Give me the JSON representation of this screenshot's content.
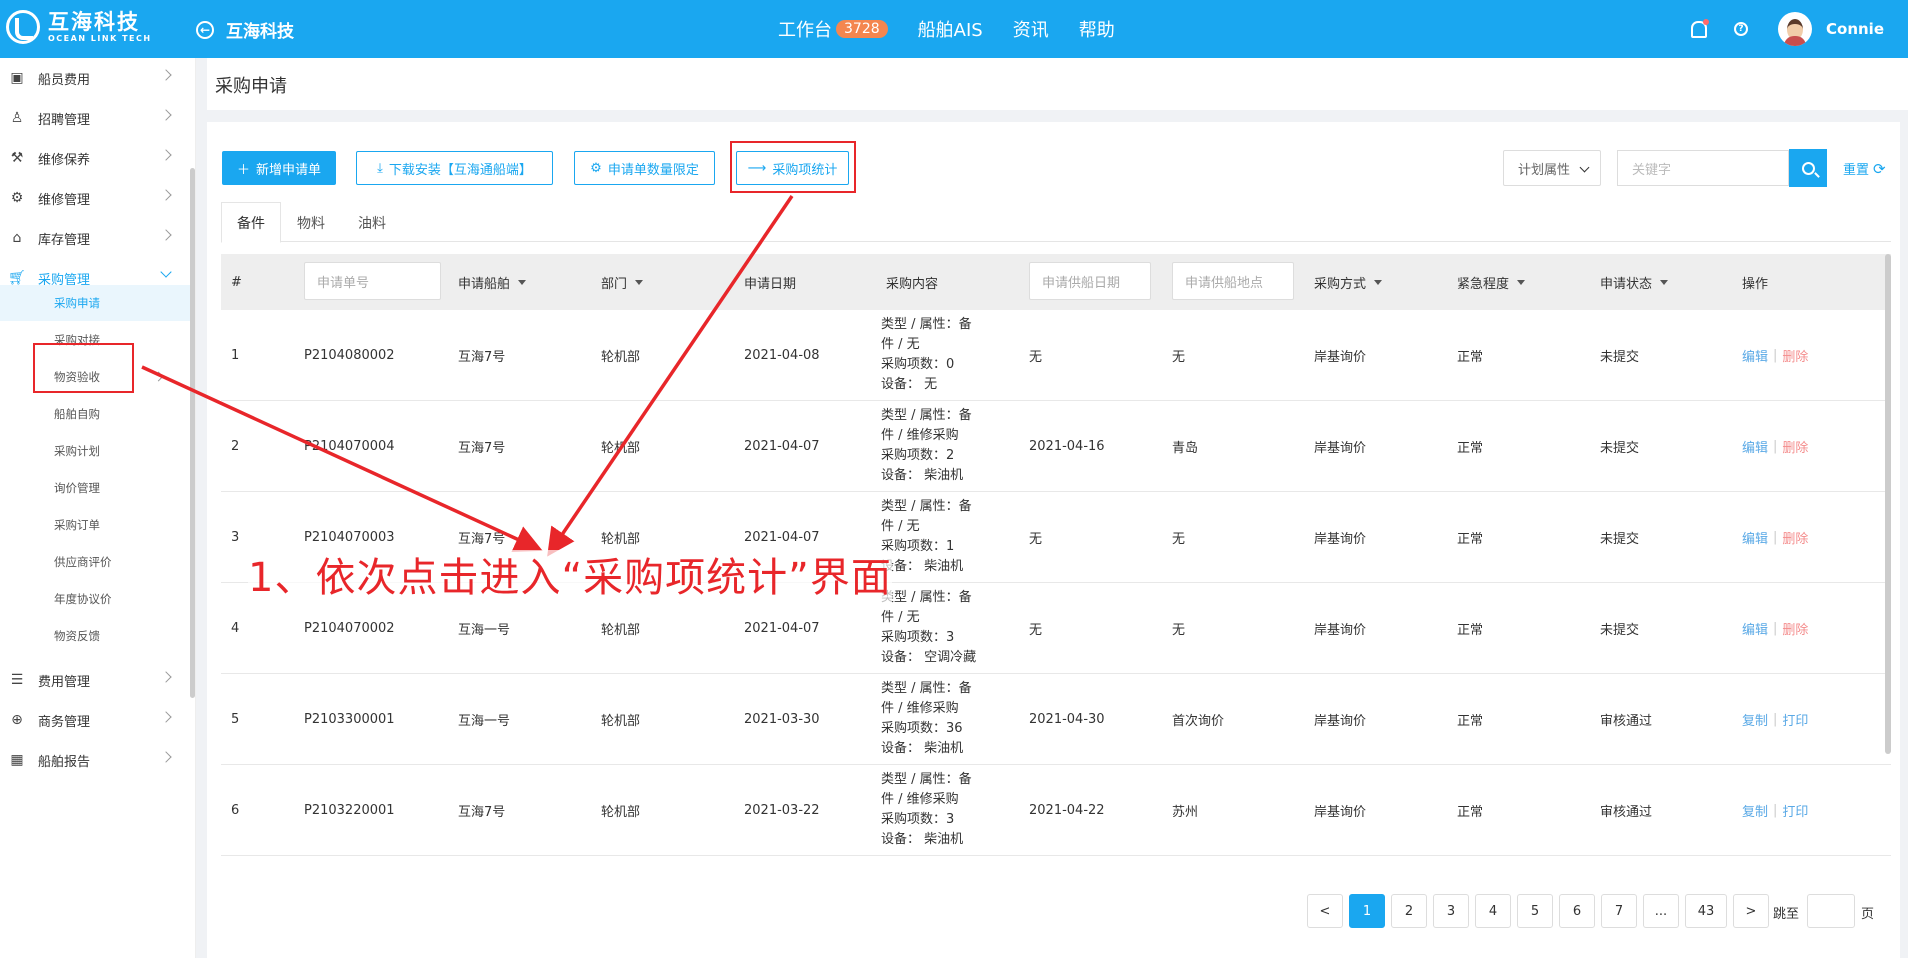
{
  "topbar": {
    "logo_cn": "互海科技",
    "logo_en": "OCEAN LINK TECH",
    "back_label": "互海科技",
    "nav": [
      {
        "label": "工作台",
        "badge": "3728"
      },
      {
        "label": "船舶AIS"
      },
      {
        "label": "资讯"
      },
      {
        "label": "帮助"
      }
    ],
    "username": "Connie"
  },
  "sidebar": {
    "items": [
      {
        "label": "船员费用",
        "icon": "wallet-icon"
      },
      {
        "label": "招聘管理",
        "icon": "user-icon"
      },
      {
        "label": "维修保养",
        "icon": "hammer-icon"
      },
      {
        "label": "维修管理",
        "icon": "wrench-icon"
      },
      {
        "label": "库存管理",
        "icon": "home-icon"
      },
      {
        "label": "采购管理",
        "icon": "cart-icon"
      }
    ],
    "sub_items": [
      "采购申请",
      "采购对接",
      "物资验收",
      "船舶自购",
      "采购计划",
      "询价管理",
      "采购订单",
      "供应商评价",
      "年度协议价",
      "物资反馈"
    ],
    "bottom_items": [
      {
        "label": "费用管理",
        "icon": "database-icon"
      },
      {
        "label": "商务管理",
        "icon": "globe-icon"
      },
      {
        "label": "船舶报告",
        "icon": "calendar-icon"
      }
    ]
  },
  "page": {
    "title": "采购申请"
  },
  "toolbar": {
    "new_label": "新增申请单",
    "download_label": "下载安装【互海通船端】",
    "limit_label": "申请单数量限定",
    "stats_label": "采购项统计",
    "plan_select": "计划属性",
    "keyword_placeholder": "关键字",
    "reset_label": "重置"
  },
  "tabs": [
    "备件",
    "物料",
    "油料"
  ],
  "table": {
    "headers": {
      "index": "#",
      "apply_no_placeholder": "申请单号",
      "ship": "申请船舶",
      "dept": "部门",
      "date": "申请日期",
      "content": "采购内容",
      "supply_date_placeholder": "申请供船日期",
      "supply_place_placeholder": "申请供船地点",
      "method": "采购方式",
      "urgency": "紧急程度",
      "status": "申请状态",
      "ops": "操作"
    },
    "rows": [
      {
        "idx": "1",
        "no": "P2104080002",
        "ship": "互海7号",
        "dept": "轮机部",
        "date": "2021-04-08",
        "c1": "类型 / 属性：备",
        "c2": "件 / 无",
        "c3": "采购项数：0",
        "c4": "设备：  无",
        "supply_date": "无",
        "place": "无",
        "method": "岸基询价",
        "urgency": "正常",
        "status": "未提交",
        "op1": "编辑",
        "op2": "删除"
      },
      {
        "idx": "2",
        "no": "P2104070004",
        "ship": "互海7号",
        "dept": "轮机部",
        "date": "2021-04-07",
        "c1": "类型 / 属性：备",
        "c2": "件 / 维修采购",
        "c3": "采购项数：2",
        "c4": "设备：  柴油机",
        "supply_date": "2021-04-16",
        "place": "青岛",
        "method": "岸基询价",
        "urgency": "正常",
        "status": "未提交",
        "op1": "编辑",
        "op2": "删除"
      },
      {
        "idx": "3",
        "no": "P2104070003",
        "ship": "互海7号",
        "dept": "轮机部",
        "date": "2021-04-07",
        "c1": "类型 / 属性：备",
        "c2": "件 / 无",
        "c3": "采购项数：1",
        "c4": "设备：  柴油机",
        "supply_date": "无",
        "place": "无",
        "method": "岸基询价",
        "urgency": "正常",
        "status": "未提交",
        "op1": "编辑",
        "op2": "删除"
      },
      {
        "idx": "4",
        "no": "P2104070002",
        "ship": "互海一号",
        "dept": "轮机部",
        "date": "2021-04-07",
        "c1": "类型 / 属性：备",
        "c2": "件 / 无",
        "c3": "采购项数：3",
        "c4": "设备：  空调冷藏",
        "supply_date": "无",
        "place": "无",
        "method": "岸基询价",
        "urgency": "正常",
        "status": "未提交",
        "op1": "编辑",
        "op2": "删除"
      },
      {
        "idx": "5",
        "no": "P2103300001",
        "ship": "互海一号",
        "dept": "轮机部",
        "date": "2021-03-30",
        "c1": "类型 / 属性：备",
        "c2": "件 / 维修采购",
        "c3": "采购项数：36",
        "c4": "设备：  柴油机",
        "supply_date": "2021-04-30",
        "place": "首次询价",
        "method": "岸基询价",
        "urgency": "正常",
        "status": "审核通过",
        "op1": "复制",
        "op2": "打印"
      },
      {
        "idx": "6",
        "no": "P2103220001",
        "ship": "互海7号",
        "dept": "轮机部",
        "date": "2021-03-22",
        "c1": "类型 / 属性：备",
        "c2": "件 / 维修采购",
        "c3": "采购项数：3",
        "c4": "设备：  柴油机",
        "supply_date": "2021-04-22",
        "place": "苏州",
        "method": "岸基询价",
        "urgency": "正常",
        "status": "审核通过",
        "op1": "复制",
        "op2": "打印"
      }
    ]
  },
  "pagination": {
    "prev": "<",
    "pages": [
      "1",
      "2",
      "3",
      "4",
      "5",
      "6",
      "7",
      "...",
      "43"
    ],
    "next": ">",
    "current": "1",
    "jump_label": "跳至",
    "page_unit": "页"
  },
  "annotation": {
    "text": "1、依次点击进入“采购项统计”界面",
    "color": "#e8262a"
  },
  "colors": {
    "accent": "#1aa7f0",
    "badge": "#f4864f",
    "annotation_red": "#e8262a"
  }
}
